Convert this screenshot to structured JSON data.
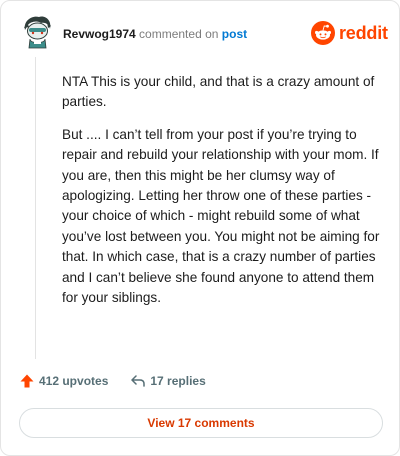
{
  "header": {
    "username": "Revwog1974",
    "action_text": "commented on",
    "link_text": "post"
  },
  "brand": {
    "wordmark": "reddit",
    "icon": "reddit-alien-icon",
    "color": "#ff4500"
  },
  "comment": {
    "paragraphs": [
      "NTA This is your child, and that is a crazy amount of parties.",
      "But .... I can’t tell from your post if you’re trying to repair and rebuild your relationship with your mom. If you are, then this might be her clumsy way of apologizing. Letting her throw one of these parties - your choice of which - might rebuild some of what you’ve lost between you. You might not be aiming for that. In which case, that is a crazy number of parties and I can’t believe she found anyone to attend them for your siblings."
    ]
  },
  "actions": {
    "upvotes": "412 upvotes",
    "replies": "17 replies",
    "upvote_icon": "upvote-arrow-icon",
    "reply_icon": "reply-arrow-icon",
    "upvote_color": "#ff4500"
  },
  "view_button": {
    "label": "View 17 comments",
    "color": "#d93900"
  }
}
